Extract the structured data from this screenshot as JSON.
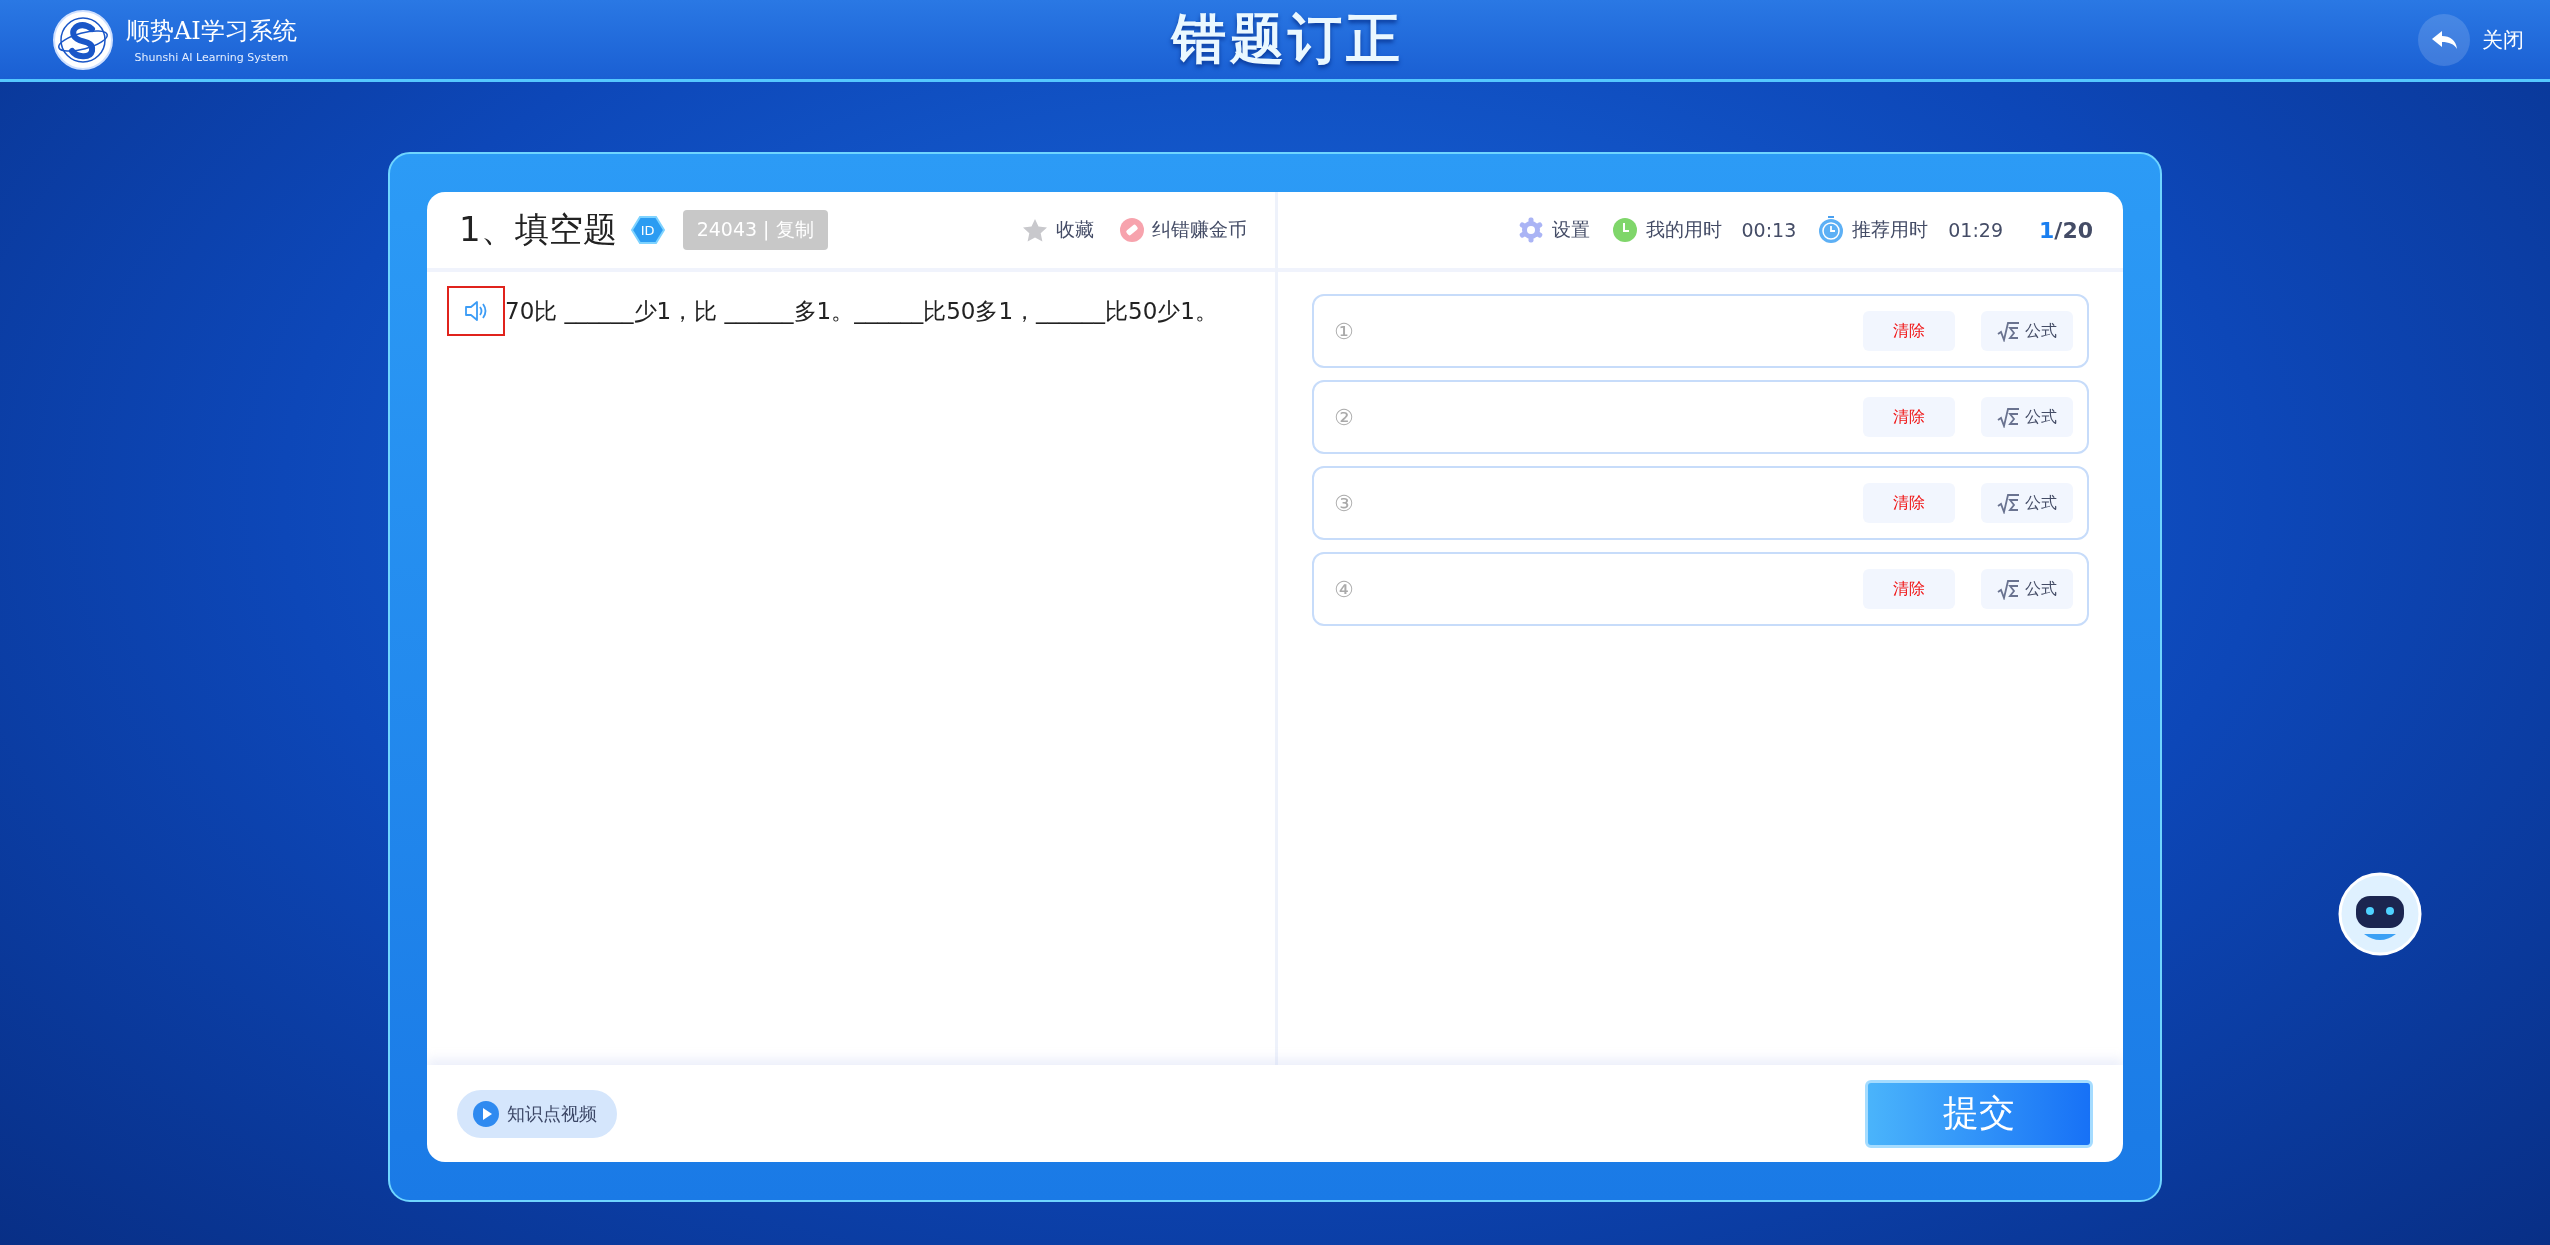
{
  "header": {
    "logo_title": "顺势AI学习系统",
    "logo_subtitle": "Shunshi AI Learning System",
    "title": "错题订正",
    "close_label": "关闭"
  },
  "question": {
    "number_title": "1、填空题",
    "id_badge": "ID",
    "id_tag": "24043 | 复制",
    "actions": [
      {
        "kind": "star",
        "label": "收藏"
      },
      {
        "kind": "eraser",
        "label": "纠错赚金币"
      }
    ],
    "speaker_highlighted": true,
    "text": "70比 ______少1，比 ______多1。______比50多1，______比50少1。"
  },
  "toolbar": {
    "settings_label": "设置",
    "my_time_label": "我的用时",
    "my_time": "00:13",
    "recommended_label": "推荐用时",
    "recommended_time": "01:29",
    "progress_current": "1",
    "progress_total": "/20"
  },
  "answers": [
    {
      "marker": "①",
      "clear_label": "清除",
      "formula_label": "公式"
    },
    {
      "marker": "②",
      "clear_label": "清除",
      "formula_label": "公式"
    },
    {
      "marker": "③",
      "clear_label": "清除",
      "formula_label": "公式"
    },
    {
      "marker": "④",
      "clear_label": "清除",
      "formula_label": "公式"
    }
  ],
  "video_button": "知识点视频",
  "submit_button": "提交"
}
